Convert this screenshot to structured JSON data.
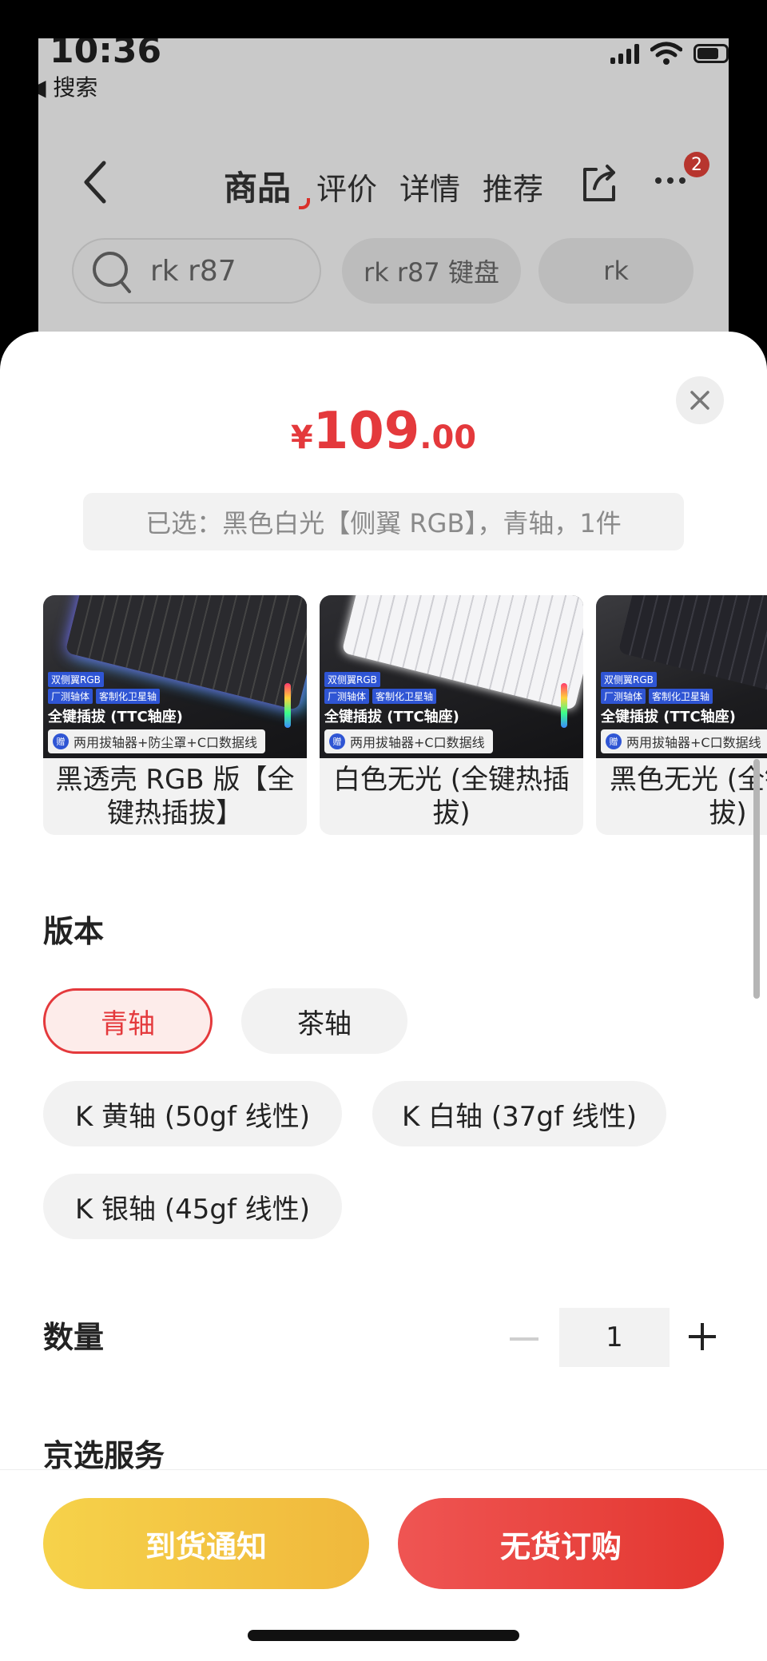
{
  "status_bar": {
    "time": "10:36",
    "back_app": "◀ 搜索"
  },
  "bg_nav": {
    "tabs": [
      {
        "label": "商品",
        "active": true
      },
      {
        "label": "评价"
      },
      {
        "label": "详情"
      },
      {
        "label": "推荐"
      }
    ],
    "badge_count": "2"
  },
  "bg_search": {
    "query": "rk r87",
    "chips": [
      "rk r87 键盘",
      "rk"
    ]
  },
  "sheet": {
    "price": {
      "symbol": "¥",
      "integer": "109",
      "decimal": ".00"
    },
    "selected_text": "已选：黑色白光【侧翼 RGB】，青轴，1件",
    "variants": [
      {
        "label": "黑透壳 RGB 版【全键热插拔】",
        "tags": [
          "双侧翼RGB",
          "厂测轴体",
          "客制化卫星轴"
        ],
        "main_tag": "全键插拔 (TTC轴座)",
        "accessory": "两用拔轴器+防尘罩+C口数据线",
        "style": "rgb"
      },
      {
        "label": "白色无光 (全键热插拔)",
        "tags": [
          "双侧翼RGB",
          "厂测轴体",
          "客制化卫星轴"
        ],
        "main_tag": "全键插拔 (TTC轴座)",
        "accessory": "两用拔轴器+C口数据线",
        "style": "white"
      },
      {
        "label": "黑色无光 (全键热插拔)",
        "tags": [
          "双侧翼RGB",
          "厂测轴体",
          "客制化卫星轴"
        ],
        "main_tag": "全键插拔 (TTC轴座)",
        "accessory": "两用拔轴器+C口数据线",
        "style": "dark"
      }
    ],
    "version_title": "版本",
    "versions": [
      {
        "label": "青轴",
        "selected": true
      },
      {
        "label": "茶轴"
      },
      {
        "label": "K 黄轴 (50gf 线性)"
      },
      {
        "label": "K 白轴 (37gf 线性)"
      },
      {
        "label": "K 银轴 (45gf 线性)"
      }
    ],
    "quantity_title": "数量",
    "quantity": "1",
    "service_title": "京选服务",
    "buttons": {
      "notify": "到货通知",
      "order": "无货订购"
    }
  },
  "colors": {
    "accent": "#e4393c",
    "notify_button": "#f6c944",
    "order_button": "#e8433f"
  }
}
